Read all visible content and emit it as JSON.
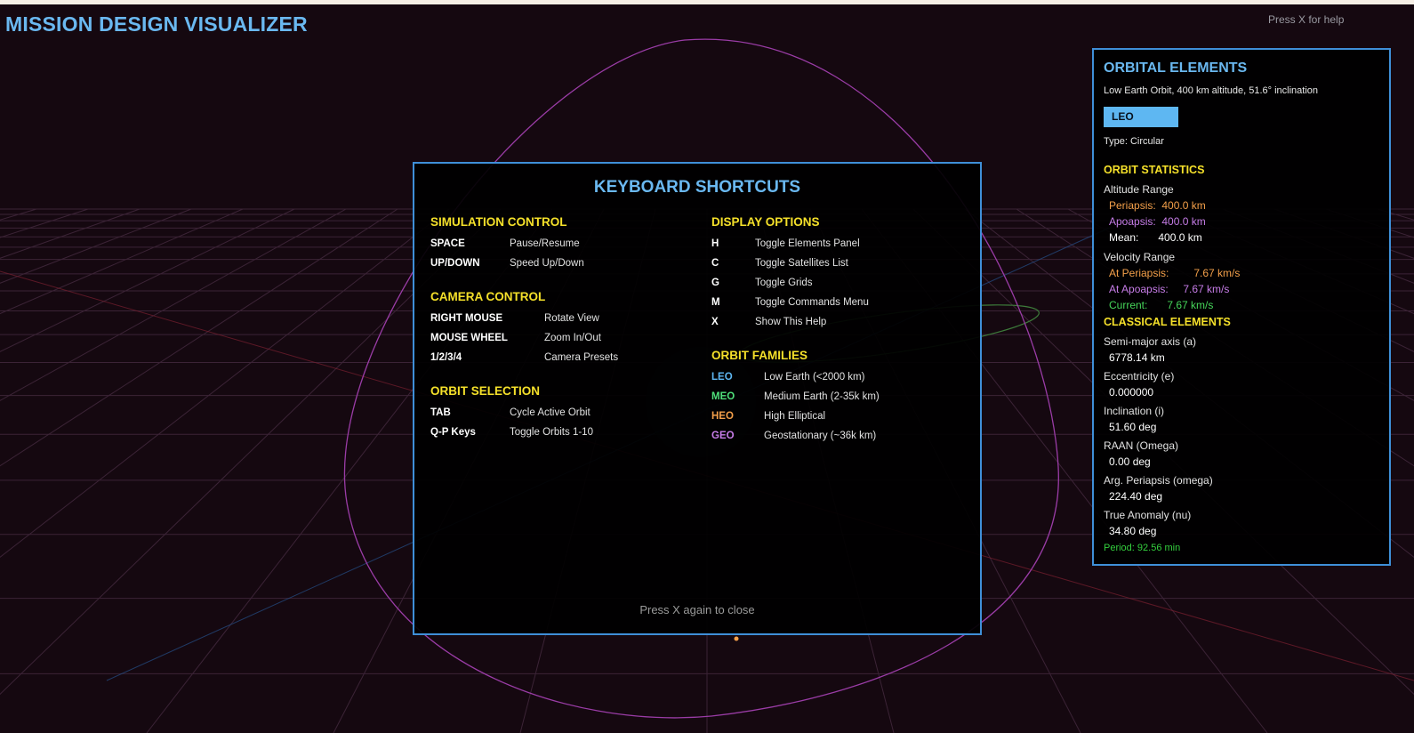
{
  "app": {
    "title": "MISSION DESIGN VISUALIZER",
    "help_hint": "Press X for help"
  },
  "shortcuts": {
    "title": "KEYBOARD SHORTCUTS",
    "footer": "Press X again to close",
    "sections_left": [
      {
        "heading": "SIMULATION CONTROL",
        "desc_offset": "short",
        "items": [
          {
            "key": "SPACE",
            "desc": "Pause/Resume"
          },
          {
            "key": "UP/DOWN",
            "desc": "Speed Up/Down"
          }
        ]
      },
      {
        "heading": "CAMERA CONTROL",
        "desc_offset": "long",
        "items": [
          {
            "key": "RIGHT MOUSE",
            "desc": "Rotate View"
          },
          {
            "key": "MOUSE WHEEL",
            "desc": "Zoom In/Out"
          },
          {
            "key": "1/2/3/4",
            "desc": "Camera Presets"
          }
        ]
      },
      {
        "heading": "ORBIT SELECTION",
        "desc_offset": "short",
        "items": [
          {
            "key": "TAB",
            "desc": "Cycle Active Orbit"
          },
          {
            "key": "Q-P Keys",
            "desc": "Toggle Orbits 1-10"
          }
        ]
      }
    ],
    "sections_right": [
      {
        "heading": "DISPLAY OPTIONS",
        "items": [
          {
            "key": "H",
            "desc": "Toggle Elements Panel"
          },
          {
            "key": "C",
            "desc": "Toggle Satellites List"
          },
          {
            "key": "G",
            "desc": "Toggle Grids"
          },
          {
            "key": "M",
            "desc": "Toggle Commands Menu"
          },
          {
            "key": "X",
            "desc": "Show This Help"
          }
        ]
      },
      {
        "heading": "ORBIT FAMILIES",
        "items": [
          {
            "key": "LEO",
            "desc": "Low Earth (<2000 km)",
            "color": "#5eb7f2"
          },
          {
            "key": "MEO",
            "desc": "Medium Earth (2-35k km)",
            "color": "#4fe07a"
          },
          {
            "key": "HEO",
            "desc": "High Elliptical",
            "color": "#f4a04a"
          },
          {
            "key": "GEO",
            "desc": "Geostationary (~36k km)",
            "color": "#c77de8"
          }
        ]
      }
    ]
  },
  "elements": {
    "title": "ORBITAL ELEMENTS",
    "description": "Low Earth Orbit, 400 km altitude, 51.6° inclination",
    "badge": "LEO",
    "type": "Type: Circular",
    "stats_heading": "ORBIT STATISTICS",
    "altitude": {
      "label": "Altitude Range",
      "periapsis_label": "Periapsis:",
      "periapsis": "400.0 km",
      "apoapsis_label": "Apoapsis:",
      "apoapsis": "400.0 km",
      "mean_label": "Mean:",
      "mean": "400.0 km"
    },
    "velocity": {
      "label": "Velocity Range",
      "periapsis_label": "At Periapsis:",
      "periapsis": "7.67 km/s",
      "apoapsis_label": "At Apoapsis:",
      "apoapsis": "7.67 km/s",
      "current_label": "Current:",
      "current": "7.67 km/s"
    },
    "classical_heading": "CLASSICAL ELEMENTS",
    "classical": [
      {
        "label": "Semi-major axis (a)",
        "value": "6778.14 km"
      },
      {
        "label": "Eccentricity (e)",
        "value": "0.000000"
      },
      {
        "label": "Inclination (i)",
        "value": "51.60 deg"
      },
      {
        "label": "RAAN (Omega)",
        "value": "0.00 deg"
      },
      {
        "label": "Arg. Periapsis (omega)",
        "value": "224.40 deg"
      },
      {
        "label": "True Anomaly (nu)",
        "value": "34.80 deg"
      }
    ],
    "period": "Period: 92.56 min"
  },
  "colors": {
    "accent": "#6ab8f0",
    "heading": "#f5e02a",
    "border": "#3f8fd8",
    "orbit": "#9a3ca6",
    "grid": "#5a3a55",
    "periapsis": "#f4a04a",
    "apoapsis": "#c77de8",
    "current": "#46d65a"
  }
}
